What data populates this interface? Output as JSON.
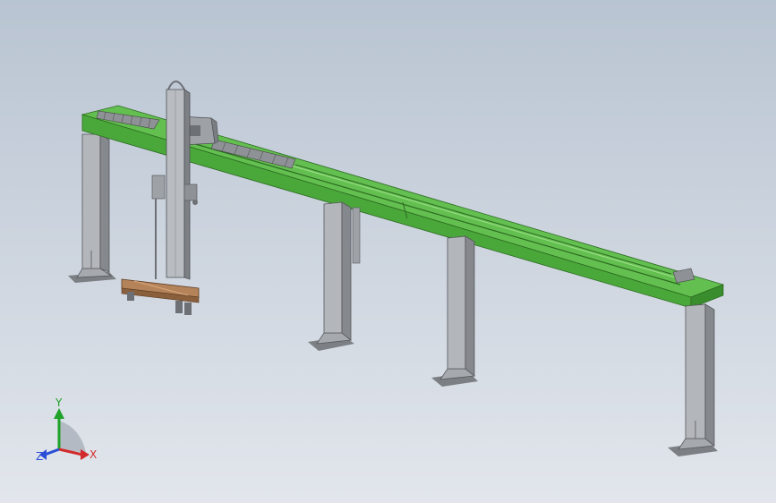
{
  "viewport": {
    "background_top": "#b9c4d2",
    "background_bottom": "#e2e6ec"
  },
  "model": {
    "beam_color": "#4aa83a",
    "beam_dark": "#2f7f26",
    "beam_light": "#77cf61",
    "steel_color": "#a8abb0",
    "steel_dark": "#6d7075",
    "fork_color": "#b4835a"
  },
  "triad": {
    "x_label": "X",
    "y_label": "Y",
    "z_label": "Z",
    "x_color": "#d22b2b",
    "y_color": "#1fa12a",
    "z_color": "#2a4fd6"
  }
}
